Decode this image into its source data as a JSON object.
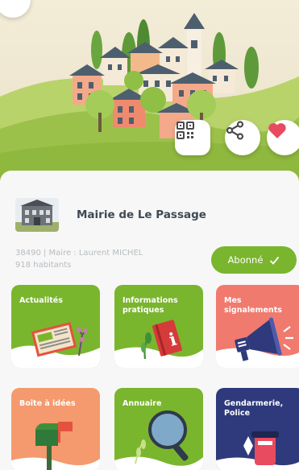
{
  "header": {
    "qr_icon": "qr-code-icon",
    "share_icon": "share-icon",
    "favorite_icon": "heart-icon",
    "back_icon": "back-icon"
  },
  "commune": {
    "name": "Mairie de Le Passage",
    "info_line": "38490 | Maire : Laurent MICHEL",
    "population": "918 habitants",
    "follow_label": "Abonné",
    "follow_icon": "check-icon"
  },
  "tiles": [
    {
      "label": "Actualités",
      "color": "#7ab52e",
      "icon": "newspaper-icon"
    },
    {
      "label": "Informations pratiques",
      "color": "#7ab52e",
      "icon": "info-book-icon"
    },
    {
      "label": "Mes signalements",
      "color": "#f07a6e",
      "icon": "megaphone-icon"
    },
    {
      "label": "Boîte à idées",
      "color": "#f49a6e",
      "icon": "mailbox-icon"
    },
    {
      "label": "Annuaire",
      "color": "#7ab52e",
      "icon": "magnifier-icon"
    },
    {
      "label": "Gendarmerie, Police",
      "color": "#2f3a7c",
      "icon": "police-icon"
    }
  ],
  "colors": {
    "accent_green": "#7ab52e",
    "heart_red": "#e84a5f",
    "title_gray": "#3d4a55"
  }
}
